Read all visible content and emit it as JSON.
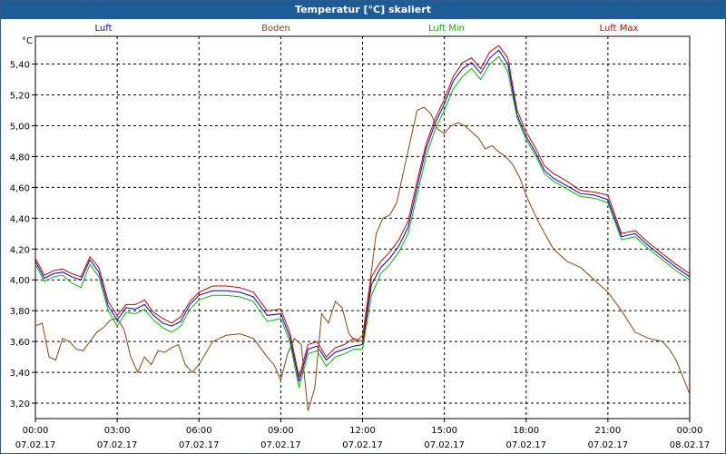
{
  "window": {
    "title": "Temperatur [°C] skaliert"
  },
  "chart_data": {
    "type": "line",
    "title": "Temperatur [°C] skaliert",
    "ylabel": "°C",
    "xlabel": "",
    "ylim": [
      3.1,
      5.58
    ],
    "grid": true,
    "legend_position": "top",
    "x_ticks": [
      {
        "time": "00:00",
        "date": "07.02.17"
      },
      {
        "time": "03:00",
        "date": "07.02.17"
      },
      {
        "time": "06:00",
        "date": "07.02.17"
      },
      {
        "time": "09:00",
        "date": "07.02.17"
      },
      {
        "time": "12:00",
        "date": "07.02.17"
      },
      {
        "time": "15:00",
        "date": "07.02.17"
      },
      {
        "time": "18:00",
        "date": "07.02.17"
      },
      {
        "time": "21:00",
        "date": "07.02.17"
      },
      {
        "time": "00:00",
        "date": "08.02.17"
      }
    ],
    "y_ticks": [
      "3,20",
      "3,40",
      "3,60",
      "3,80",
      "4,00",
      "4,20",
      "4,40",
      "4,60",
      "4,80",
      "5,00",
      "5,20",
      "5,40"
    ],
    "y_tick_values": [
      3.2,
      3.4,
      3.6,
      3.8,
      4.0,
      4.2,
      4.4,
      4.6,
      4.8,
      5.0,
      5.2,
      5.4
    ],
    "series": [
      {
        "name": "Luft",
        "color": "#0000cc",
        "hours": [
          0,
          0.33,
          0.67,
          1,
          1.33,
          1.67,
          2,
          2.33,
          2.67,
          3,
          3.33,
          3.67,
          4,
          4.33,
          4.67,
          5,
          5.33,
          5.67,
          6,
          6.5,
          7,
          7.5,
          8,
          8.5,
          9,
          9.33,
          9.67,
          10,
          10.33,
          10.67,
          11,
          11.33,
          11.67,
          12,
          12.33,
          12.67,
          13,
          13.33,
          13.67,
          14,
          14.33,
          14.67,
          15,
          15.33,
          15.67,
          16,
          16.33,
          16.67,
          17,
          17.33,
          17.67,
          18,
          18.33,
          18.67,
          19,
          19.5,
          20,
          20.5,
          21,
          21.5,
          22,
          22.5,
          23,
          23.5,
          24
        ],
        "values": [
          4.12,
          4.01,
          4.04,
          4.05,
          4.02,
          4.0,
          4.13,
          4.05,
          3.83,
          3.74,
          3.82,
          3.81,
          3.84,
          3.77,
          3.72,
          3.7,
          3.73,
          3.84,
          3.9,
          3.93,
          3.93,
          3.92,
          3.89,
          3.77,
          3.78,
          3.63,
          3.34,
          3.55,
          3.57,
          3.48,
          3.53,
          3.55,
          3.57,
          3.58,
          3.97,
          4.08,
          4.14,
          4.22,
          4.34,
          4.6,
          4.85,
          5.02,
          5.14,
          5.29,
          5.37,
          5.41,
          5.34,
          5.44,
          5.49,
          5.4,
          5.07,
          4.93,
          4.83,
          4.71,
          4.66,
          4.61,
          4.56,
          4.55,
          4.52,
          4.28,
          4.3,
          4.22,
          4.15,
          4.08,
          4.02
        ]
      },
      {
        "name": "Boden",
        "color": "#8b4513",
        "hours": [
          0,
          0.25,
          0.5,
          0.75,
          1,
          1.25,
          1.5,
          1.75,
          2,
          2.25,
          2.5,
          2.75,
          3,
          3.25,
          3.5,
          3.75,
          4,
          4.25,
          4.5,
          4.75,
          5,
          5.25,
          5.5,
          5.75,
          6,
          6.5,
          7,
          7.5,
          8,
          8.25,
          8.5,
          8.75,
          9,
          9.25,
          9.5,
          9.75,
          10,
          10.25,
          10.5,
          10.75,
          11,
          11.25,
          11.5,
          11.75,
          12,
          12.25,
          12.5,
          12.75,
          13,
          13.25,
          13.5,
          13.75,
          14,
          14.25,
          14.5,
          14.75,
          15,
          15.25,
          15.5,
          15.75,
          16,
          16.25,
          16.5,
          16.75,
          17,
          17.25,
          17.5,
          17.75,
          18,
          18.25,
          18.5,
          18.75,
          19,
          19.5,
          20,
          20.5,
          21,
          21.5,
          22,
          22.5,
          23,
          23.25,
          23.5,
          23.75,
          24
        ],
        "values": [
          3.7,
          3.72,
          3.5,
          3.48,
          3.62,
          3.6,
          3.55,
          3.54,
          3.6,
          3.66,
          3.69,
          3.74,
          3.75,
          3.68,
          3.5,
          3.4,
          3.5,
          3.45,
          3.54,
          3.53,
          3.56,
          3.58,
          3.45,
          3.4,
          3.45,
          3.6,
          3.64,
          3.65,
          3.62,
          3.56,
          3.5,
          3.45,
          3.35,
          3.52,
          3.62,
          3.58,
          3.15,
          3.3,
          3.78,
          3.72,
          3.86,
          3.82,
          3.65,
          3.6,
          3.64,
          3.95,
          4.3,
          4.4,
          4.42,
          4.5,
          4.7,
          4.9,
          5.1,
          5.12,
          5.08,
          4.98,
          4.95,
          5.0,
          5.02,
          5.0,
          4.96,
          4.92,
          4.85,
          4.87,
          4.83,
          4.8,
          4.75,
          4.67,
          4.55,
          4.45,
          4.36,
          4.28,
          4.2,
          4.12,
          4.08,
          4.0,
          3.92,
          3.8,
          3.66,
          3.62,
          3.6,
          3.55,
          3.48,
          3.37,
          3.26
        ]
      },
      {
        "name": "Luft Min",
        "color": "#00bb00",
        "hours": [
          0,
          0.33,
          0.67,
          1,
          1.33,
          1.67,
          2,
          2.33,
          2.67,
          3,
          3.33,
          3.67,
          4,
          4.33,
          4.67,
          5,
          5.33,
          5.67,
          6,
          6.5,
          7,
          7.5,
          8,
          8.5,
          9,
          9.33,
          9.67,
          10,
          10.33,
          10.67,
          11,
          11.33,
          11.67,
          12,
          12.33,
          12.67,
          13,
          13.33,
          13.67,
          14,
          14.33,
          14.67,
          15,
          15.33,
          15.67,
          16,
          16.33,
          16.67,
          17,
          17.33,
          17.67,
          18,
          18.33,
          18.67,
          19,
          19.5,
          20,
          20.5,
          21,
          21.5,
          22,
          22.5,
          23,
          23.5,
          24
        ],
        "values": [
          4.1,
          3.99,
          4.02,
          4.03,
          3.98,
          3.95,
          4.1,
          4.02,
          3.8,
          3.7,
          3.79,
          3.78,
          3.81,
          3.74,
          3.69,
          3.66,
          3.7,
          3.81,
          3.87,
          3.9,
          3.9,
          3.89,
          3.86,
          3.73,
          3.75,
          3.6,
          3.3,
          3.52,
          3.54,
          3.44,
          3.5,
          3.52,
          3.55,
          3.55,
          3.9,
          4.04,
          4.1,
          4.18,
          4.3,
          4.55,
          4.8,
          4.98,
          5.1,
          5.24,
          5.32,
          5.37,
          5.3,
          5.4,
          5.45,
          5.35,
          5.05,
          4.91,
          4.81,
          4.69,
          4.64,
          4.59,
          4.54,
          4.53,
          4.5,
          4.26,
          4.28,
          4.2,
          4.13,
          4.06,
          4.0
        ]
      },
      {
        "name": "Luft Max",
        "color": "#cc0000",
        "hours": [
          0,
          0.33,
          0.67,
          1,
          1.33,
          1.67,
          2,
          2.33,
          2.67,
          3,
          3.33,
          3.67,
          4,
          4.33,
          4.67,
          5,
          5.33,
          5.67,
          6,
          6.5,
          7,
          7.5,
          8,
          8.5,
          9,
          9.33,
          9.67,
          10,
          10.33,
          10.67,
          11,
          11.33,
          11.67,
          12,
          12.33,
          12.67,
          13,
          13.33,
          13.67,
          14,
          14.33,
          14.67,
          15,
          15.33,
          15.67,
          16,
          16.33,
          16.67,
          17,
          17.33,
          17.67,
          18,
          18.33,
          18.67,
          19,
          19.5,
          20,
          20.5,
          21,
          21.5,
          22,
          22.5,
          23,
          23.5,
          24
        ],
        "values": [
          4.14,
          4.03,
          4.06,
          4.07,
          4.04,
          4.02,
          4.15,
          4.08,
          3.86,
          3.77,
          3.84,
          3.84,
          3.87,
          3.79,
          3.75,
          3.72,
          3.76,
          3.86,
          3.92,
          3.96,
          3.96,
          3.95,
          3.92,
          3.8,
          3.81,
          3.66,
          3.37,
          3.58,
          3.6,
          3.5,
          3.56,
          3.58,
          3.62,
          3.6,
          4.02,
          4.12,
          4.18,
          4.26,
          4.38,
          4.64,
          4.88,
          5.05,
          5.17,
          5.32,
          5.41,
          5.44,
          5.37,
          5.48,
          5.52,
          5.44,
          5.1,
          4.96,
          4.86,
          4.74,
          4.69,
          4.64,
          4.58,
          4.57,
          4.55,
          4.3,
          4.32,
          4.24,
          4.17,
          4.1,
          4.04
        ]
      }
    ]
  }
}
